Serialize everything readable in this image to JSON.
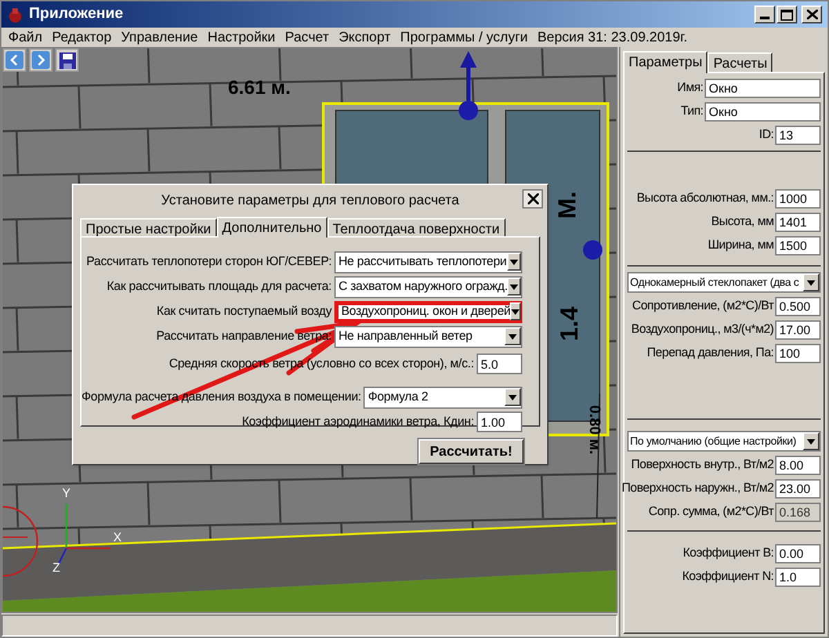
{
  "window": {
    "title": "Приложение"
  },
  "menu": [
    "Файл",
    "Редактор",
    "Управление",
    "Настройки",
    "Расчет",
    "Экспорт",
    "Программы / услуги",
    "Версия 31: 23.09.2019г."
  ],
  "scene": {
    "labels": [
      {
        "kind": "horizontal",
        "text": "6.61 м."
      },
      {
        "kind": "vertical",
        "text": "1.4"
      },
      {
        "kind": "vertical",
        "text": "М."
      },
      {
        "kind": "vertical_down",
        "text": "0.80 м."
      }
    ],
    "axes": [
      "X",
      "Y",
      "Z"
    ]
  },
  "dialog": {
    "title": "Установите параметры для теплового расчета",
    "tabs": [
      {
        "label": "Простые настройки",
        "selected": false
      },
      {
        "label": "Дополнительно",
        "selected": true
      },
      {
        "label": "Теплоотдача поверхности",
        "selected": false
      }
    ],
    "rows": [
      {
        "label": "Рассчитать теплопотери сторон ЮГ/СЕВЕР:",
        "kind": "select",
        "value": "Не рассчитывать теплопотери",
        "highlighted": false
      },
      {
        "label": "Как рассчитывать площадь для расчета:",
        "kind": "select",
        "value": "С захватом наружного огражд.",
        "highlighted": false
      },
      {
        "label": "Как считать поступаемый возду",
        "kind": "select",
        "value": "Воздухопрониц. окон и дверей",
        "highlighted": true
      },
      {
        "label": "Рассчитать направление ветра:",
        "kind": "select",
        "value": "Не направленный ветер",
        "highlighted": false
      },
      {
        "label": "Средняя скорость ветра (условно со всех сторон), м/с.:",
        "kind": "input",
        "value": "5.0",
        "highlighted": false
      },
      {
        "label": "Формула расчета давления воздуха в помещении:",
        "kind": "select",
        "value": "Формула 2",
        "highlighted": false
      },
      {
        "label": "Коэффициент аэродинамики ветра, Кдин:",
        "kind": "input",
        "value": "1.00",
        "highlighted": false
      }
    ],
    "button": "Рассчитать!"
  },
  "panel": {
    "tabs": [
      {
        "label": "Параметры",
        "selected": true
      },
      {
        "label": "Расчеты",
        "selected": false
      }
    ],
    "groups": [
      [
        {
          "kind": "input",
          "label": "Имя:",
          "value": "Окно",
          "disabled": false
        },
        {
          "kind": "input",
          "label": "Тип:",
          "value": "Окно",
          "disabled": false
        },
        {
          "kind": "short",
          "label": "ID:",
          "value": "13",
          "disabled": false
        }
      ],
      [
        {
          "kind": "input",
          "label": "Высота абсолютная, мм.:",
          "value": "1000",
          "disabled": false
        },
        {
          "kind": "input",
          "label": "Высота, мм",
          "value": "1401",
          "disabled": false
        },
        {
          "kind": "input",
          "label": "Ширина, мм",
          "value": "1500",
          "disabled": false
        }
      ],
      [
        {
          "kind": "select",
          "value": "Однокамерный стеклопакет (два с",
          "disabled": false
        },
        {
          "kind": "input",
          "label": "Сопротивление, (м2*С)/Вт",
          "value": "0.500",
          "disabled": false
        },
        {
          "kind": "input",
          "label": "Воздухопрониц., м3/(ч*м2)",
          "value": "17.00",
          "disabled": false
        },
        {
          "kind": "input",
          "label": "Перепад давления, Па:",
          "value": "100",
          "disabled": false
        }
      ],
      [
        {
          "kind": "select",
          "value": "По умолчанию (общие настройки)",
          "disabled": false
        },
        {
          "kind": "input",
          "label": "Поверхность внутр., Вт/м2",
          "value": "8.00",
          "disabled": false
        },
        {
          "kind": "input",
          "label": "Поверхность наружн., Вт/м2",
          "value": "23.00",
          "disabled": false
        },
        {
          "kind": "input",
          "label": "Сопр. сумма, (м2*С)/Вт",
          "value": "0.168",
          "disabled": true
        }
      ],
      [
        {
          "kind": "input",
          "label": "Коэффициент B:",
          "value": "0.00",
          "disabled": false
        },
        {
          "kind": "input",
          "label": "Коэффициент N:",
          "value": "1.0",
          "disabled": false
        }
      ]
    ]
  }
}
